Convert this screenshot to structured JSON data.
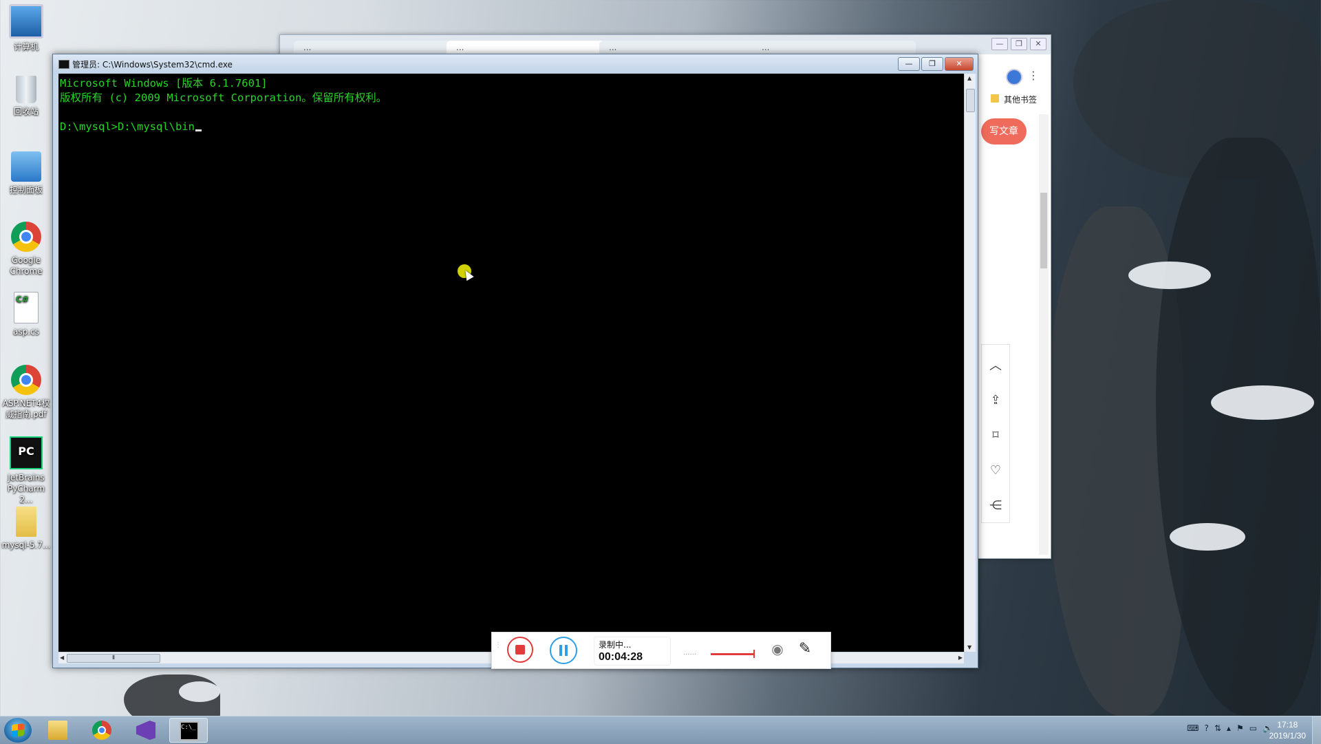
{
  "desktop": {
    "icons": [
      {
        "label": "计算机",
        "icon": "computer-icon"
      },
      {
        "label": "回收站",
        "icon": "recycle-bin-icon"
      },
      {
        "label": "控制面板",
        "icon": "control-panel-icon"
      },
      {
        "label": "Google Chrome",
        "icon": "chrome-icon"
      },
      {
        "label": "asp.cs",
        "icon": "csharp-file-icon"
      },
      {
        "label": "ASP.NET4权威指南.pdf",
        "icon": "chrome-pdf-icon"
      },
      {
        "label": "JetBrains PyCharm 2...",
        "icon": "pycharm-icon"
      },
      {
        "label": "mysql-5.7...",
        "icon": "folder-icon"
      }
    ]
  },
  "browser": {
    "tabs": [
      {
        "label": "..."
      },
      {
        "label": "..."
      },
      {
        "label": "..."
      },
      {
        "label": "..."
      }
    ],
    "bookmark_label": "其他书签",
    "write_button": "写文章",
    "side_tools": [
      {
        "icon": "chevron-up-icon",
        "glyph": "︿"
      },
      {
        "icon": "share-upload-icon",
        "glyph": "⇪"
      },
      {
        "icon": "bookmark-icon",
        "glyph": "⌑"
      },
      {
        "icon": "heart-icon",
        "glyph": "♡"
      },
      {
        "icon": "share-icon",
        "glyph": "⋲"
      }
    ]
  },
  "cmd": {
    "title": "管理员: C:\\Windows\\System32\\cmd.exe",
    "controls": {
      "minimize": "—",
      "restore": "❐",
      "close": "✕"
    },
    "lines": [
      "Microsoft Windows [版本 6.1.7601]",
      "版权所有 (c) 2009 Microsoft Corporation。保留所有权利。",
      "",
      "D:\\mysql>D:\\mysql\\bin"
    ]
  },
  "recorder": {
    "status": "录制中...",
    "time": "00:04:28",
    "dots": "......",
    "colors": {
      "stop": "#e23b3b",
      "pause": "#2d9ee8"
    }
  },
  "taskbar": {
    "items": [
      {
        "icon": "file-explorer-icon"
      },
      {
        "icon": "chrome-icon"
      },
      {
        "icon": "visual-studio-icon"
      },
      {
        "icon": "cmd-icon",
        "active": true
      }
    ],
    "clock_time": "17:18",
    "clock_date": "2019/1/30"
  }
}
